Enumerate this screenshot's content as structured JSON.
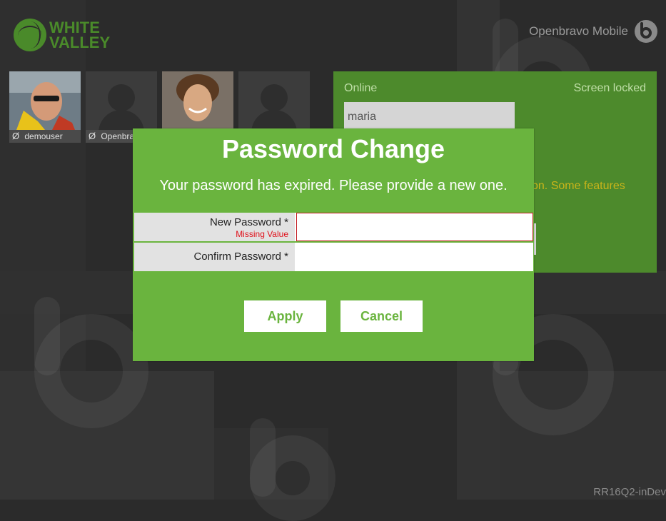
{
  "brand": {
    "logo_text_line1": "WHITE",
    "logo_text_line2": "VALLEY",
    "logo_color": "#4a8a2a"
  },
  "header": {
    "app_name": "Openbravo Mobile",
    "app_icon": "openbravo-icon"
  },
  "users": [
    {
      "status": "Ø",
      "name": "demouser",
      "avatar": "photo"
    },
    {
      "status": "Ø",
      "name": "Openbravo",
      "avatar": "silhouette"
    },
    {
      "status": "",
      "name": "",
      "avatar": "photo"
    },
    {
      "status": "",
      "name": "",
      "avatar": "silhouette"
    }
  ],
  "login_panel": {
    "online_label": "Online",
    "locked_label": "Screen locked",
    "username_value": "maria",
    "warning_text": "on. Some features",
    "panel_color": "#4d8a2c"
  },
  "modal": {
    "title": "Password Change",
    "message": "Your password has expired. Please provide a new one.",
    "new_password_label": "New Password *",
    "new_password_error": "Missing Value",
    "new_password_value": "",
    "confirm_password_label": "Confirm Password *",
    "confirm_password_value": "",
    "apply_label": "Apply",
    "cancel_label": "Cancel",
    "accent_color": "#6ab43e",
    "error_color": "#e0101a"
  },
  "footer": {
    "version": "RR16Q2-inDev"
  }
}
